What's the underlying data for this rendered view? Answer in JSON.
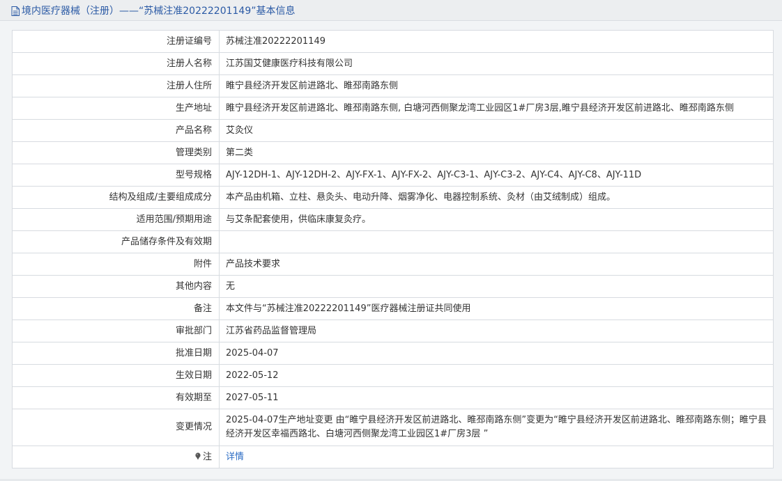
{
  "header": {
    "title": "境内医疗器械（注册）——“苏械注准20222201149”基本信息",
    "accent_color": "#2b5aa5",
    "icon": "document-icon"
  },
  "rows": [
    {
      "label": "注册证编号",
      "value": "苏械注准20222201149"
    },
    {
      "label": "注册人名称",
      "value": "江苏国艾健康医疗科技有限公司"
    },
    {
      "label": "注册人住所",
      "value": "睢宁县经济开发区前进路北、睢邳南路东侧"
    },
    {
      "label": "生产地址",
      "value": "睢宁县经济开发区前进路北、睢邳南路东侧, 白塘河西侧聚龙湾工业园区1#厂房3层,睢宁县经济开发区前进路北、睢邳南路东侧"
    },
    {
      "label": "产品名称",
      "value": "艾灸仪"
    },
    {
      "label": "管理类别",
      "value": "第二类"
    },
    {
      "label": "型号规格",
      "value": "AJY-12DH-1、AJY-12DH-2、AJY-FX-1、AJY-FX-2、AJY-C3-1、AJY-C3-2、AJY-C4、AJY-C8、AJY-11D"
    },
    {
      "label": "结构及组成/主要组成成分",
      "value": "本产品由机箱、立柱、悬灸头、电动升降、烟雾净化、电器控制系统、灸材（由艾绒制成）组成。"
    },
    {
      "label": "适用范围/预期用途",
      "value": "与艾条配套使用，供临床康复灸疗。"
    },
    {
      "label": "产品储存条件及有效期",
      "value": ""
    },
    {
      "label": "附件",
      "value": "产品技术要求"
    },
    {
      "label": "其他内容",
      "value": "无"
    },
    {
      "label": "备注",
      "value": "本文件与“苏械注准20222201149”医疗器械注册证共同使用"
    },
    {
      "label": "审批部门",
      "value": "江苏省药品监督管理局"
    },
    {
      "label": "批准日期",
      "value": "2025-04-07"
    },
    {
      "label": "生效日期",
      "value": "2022-05-12"
    },
    {
      "label": "有效期至",
      "value": "2027-05-11"
    },
    {
      "label": "变更情况",
      "value": "2025-04-07生产地址变更 由“睢宁县经济开发区前进路北、睢邳南路东侧”变更为“睢宁县经济开发区前进路北、睢邳南路东侧；睢宁县经济开发区幸福西路北、白塘河西侧聚龙湾工业园区1#厂房3层 ”"
    }
  ],
  "note": {
    "label": "注",
    "icon": "pin-icon",
    "link_text": "详情",
    "link_color": "#2b6cc4"
  }
}
